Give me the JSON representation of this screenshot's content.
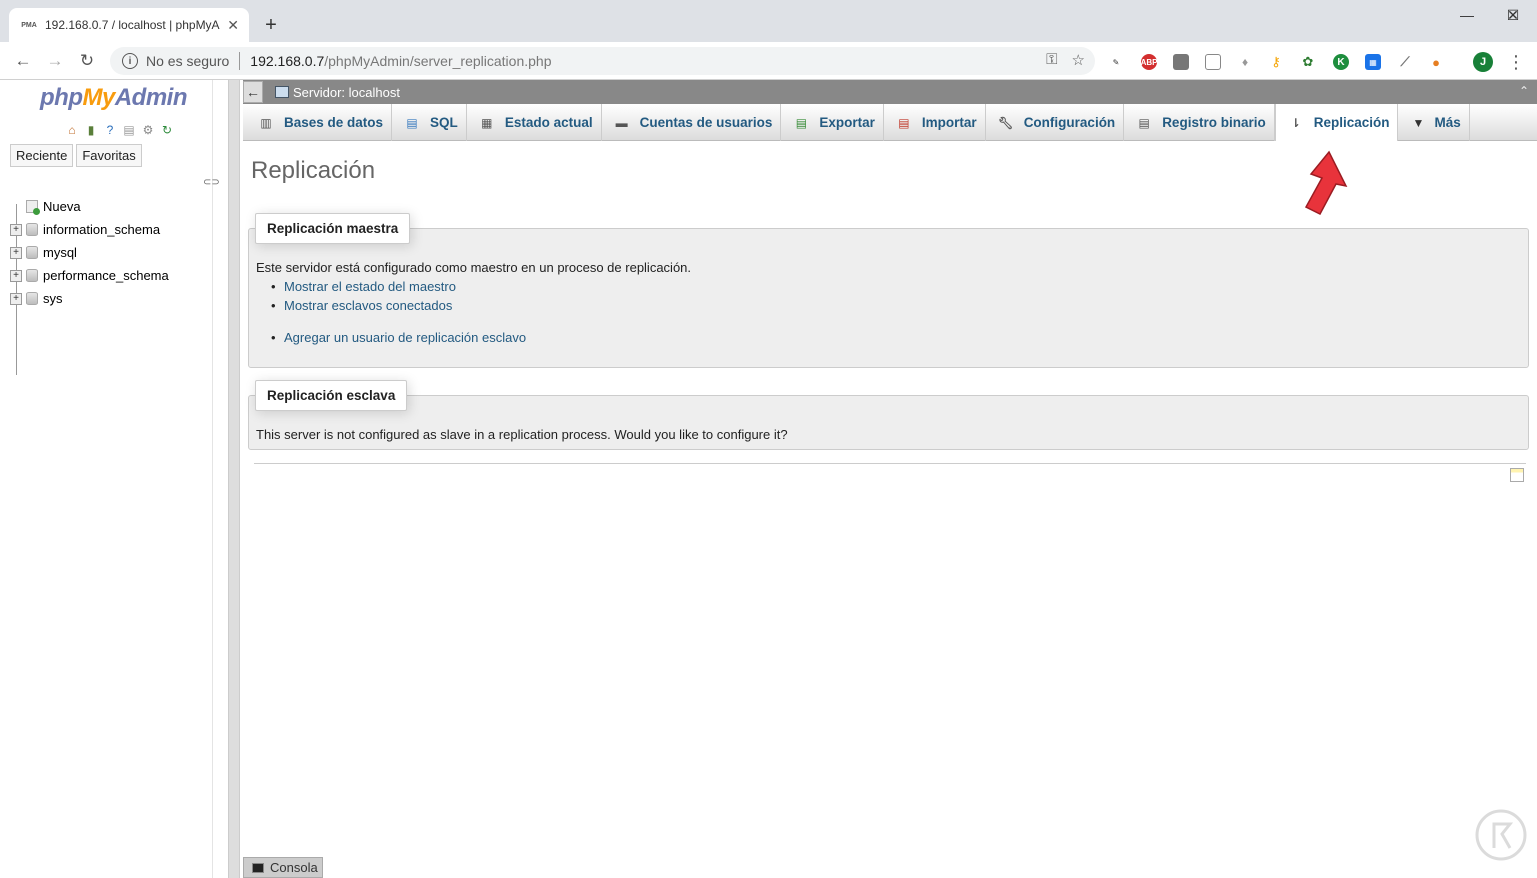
{
  "browser": {
    "tab_title": "192.168.0.7 / localhost | phpMyA",
    "tab_favicon": "PMA",
    "security_label": "No es seguro",
    "url_host": "192.168.0.7",
    "url_path": "/phpMyAdmin/server_replication.php",
    "profile_initial": "J",
    "extensions": [
      "pen-icon",
      "adblock-icon",
      "copy-icon",
      "page-icon",
      "bulb-icon",
      "key-icon",
      "plant-icon",
      "k-icon",
      "grid-icon",
      "brush-icon",
      "fox-icon"
    ]
  },
  "sidebar": {
    "logo": {
      "php": "php",
      "my": "My",
      "admin": "Admin"
    },
    "quick_tabs": [
      "Reciente",
      "Favoritas"
    ],
    "tree": [
      {
        "label": "Nueva",
        "kind": "new"
      },
      {
        "label": "information_schema",
        "kind": "db"
      },
      {
        "label": "mysql",
        "kind": "db"
      },
      {
        "label": "performance_schema",
        "kind": "db"
      },
      {
        "label": "sys",
        "kind": "db"
      }
    ]
  },
  "serverbar": {
    "label": "Servidor: localhost"
  },
  "menu": [
    {
      "label": "Bases de datos",
      "icon": "database-icon"
    },
    {
      "label": "SQL",
      "icon": "sql-icon"
    },
    {
      "label": "Estado actual",
      "icon": "status-icon"
    },
    {
      "label": "Cuentas de usuarios",
      "icon": "users-icon"
    },
    {
      "label": "Exportar",
      "icon": "export-icon"
    },
    {
      "label": "Importar",
      "icon": "import-icon"
    },
    {
      "label": "Configuración",
      "icon": "wrench-icon"
    },
    {
      "label": "Registro binario",
      "icon": "log-icon"
    },
    {
      "label": "Replicación",
      "icon": "replication-icon",
      "active": true
    },
    {
      "label": "Más",
      "icon": "triangle-down-icon"
    }
  ],
  "page": {
    "title": "Replicación",
    "master": {
      "legend": "Replicación maestra",
      "text": "Este servidor está configurado como maestro en un proceso de replicación.",
      "links": [
        "Mostrar el estado del maestro",
        "Mostrar esclavos conectados"
      ],
      "add_link": "Agregar un usuario de replicación esclavo"
    },
    "slave": {
      "legend": "Replicación esclava",
      "text": "This server is not configured as slave in a replication process. Would you like to configure it?"
    }
  },
  "console": {
    "label": "Consola"
  },
  "colors": {
    "link": "#235a81",
    "arrow": "#e8333b",
    "logo_blue": "#6c78af",
    "logo_orange": "#f89c0e"
  }
}
